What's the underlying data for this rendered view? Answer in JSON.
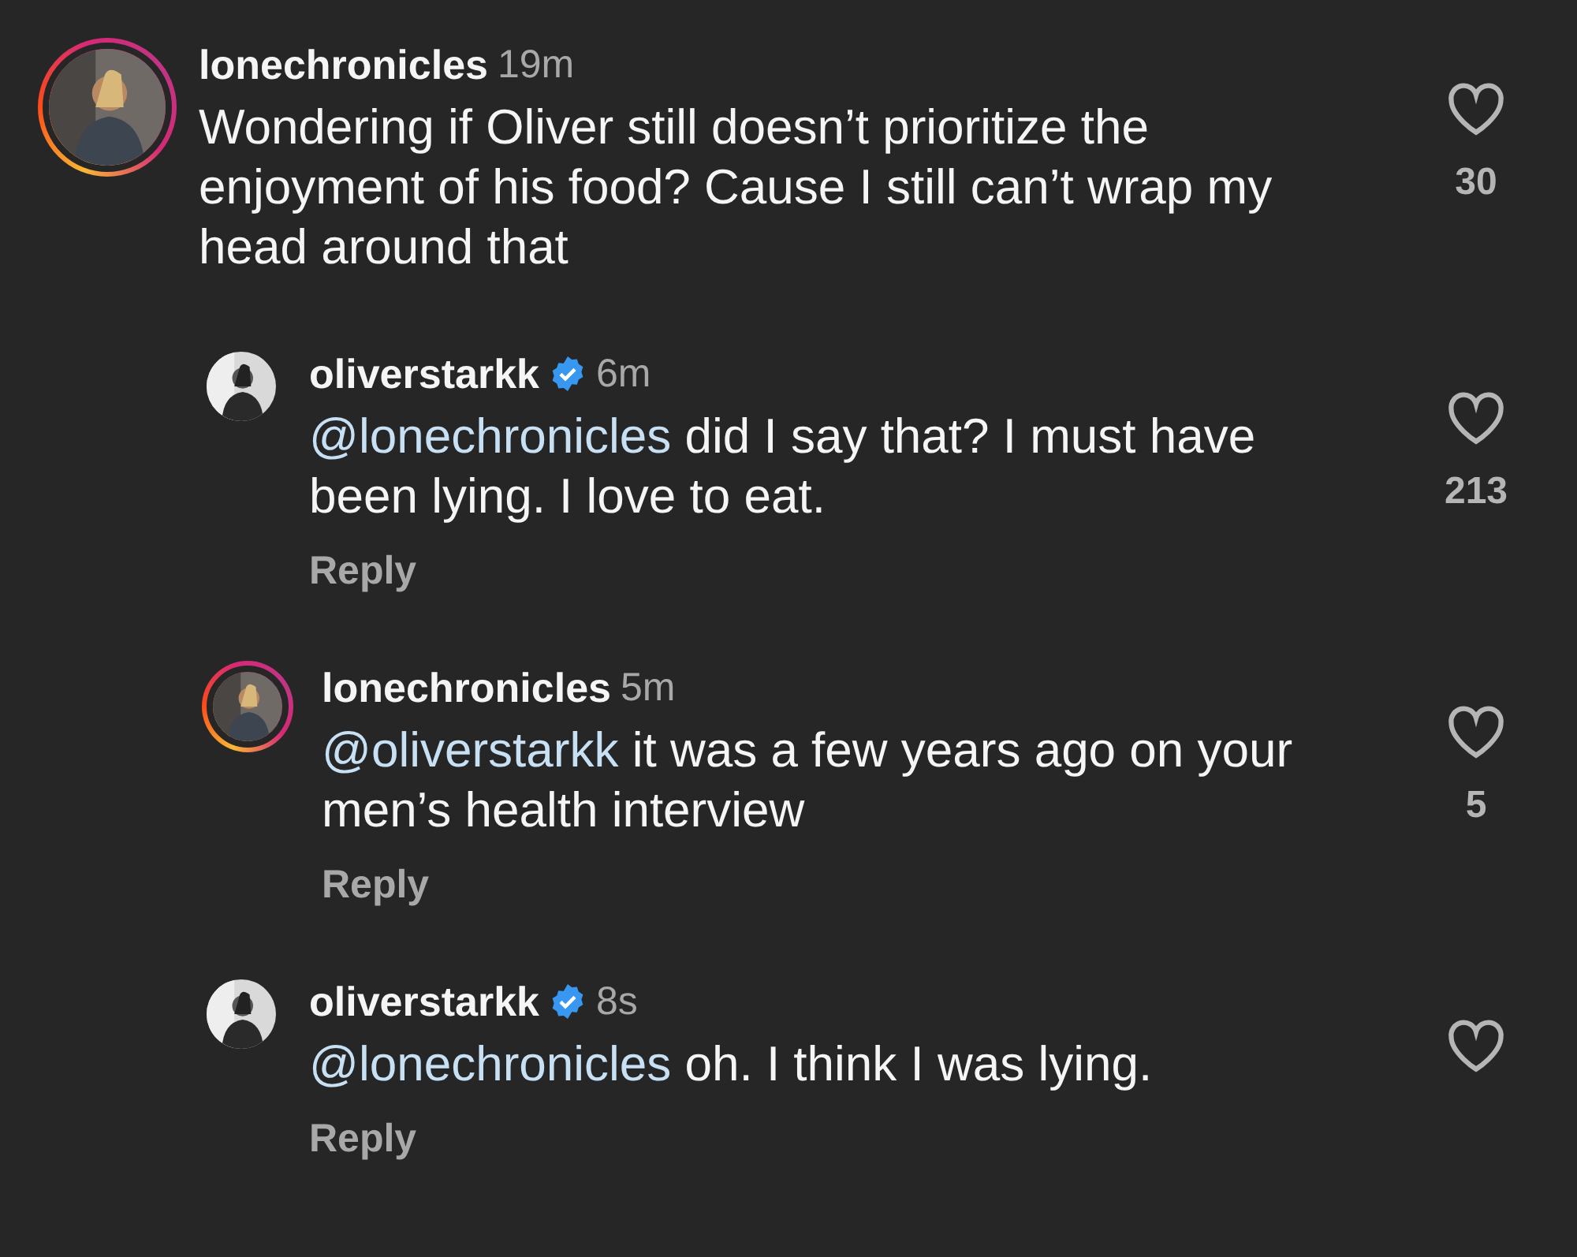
{
  "comments": [
    {
      "kind": "comment",
      "username": "lonechronicles",
      "verified": false,
      "story_ring": true,
      "time": "19m",
      "text": "Wondering if Oliver still doesn’t prioritize the enjoyment of his food? Cause I still can’t wrap my head around that",
      "likes": "30",
      "liked": false
    },
    {
      "kind": "reply",
      "username": "oliverstarkk",
      "verified": true,
      "story_ring": false,
      "time": "6m",
      "mention": "@lonechronicles",
      "text": "did I say that? I must have been lying. I love to eat.",
      "likes": "213",
      "liked": false,
      "reply_label": "Reply"
    },
    {
      "kind": "reply",
      "username": "lonechronicles",
      "verified": false,
      "story_ring": true,
      "time": "5m",
      "mention": "@oliverstarkk",
      "text": "it was a few years ago on your men’s health interview",
      "likes": "5",
      "liked": false,
      "reply_label": "Reply"
    },
    {
      "kind": "reply",
      "username": "oliverstarkk",
      "verified": true,
      "story_ring": false,
      "time": "8s",
      "mention": "@lonechronicles",
      "text": "oh. I think I was lying.",
      "liked": false,
      "reply_label": "Reply"
    }
  ]
}
